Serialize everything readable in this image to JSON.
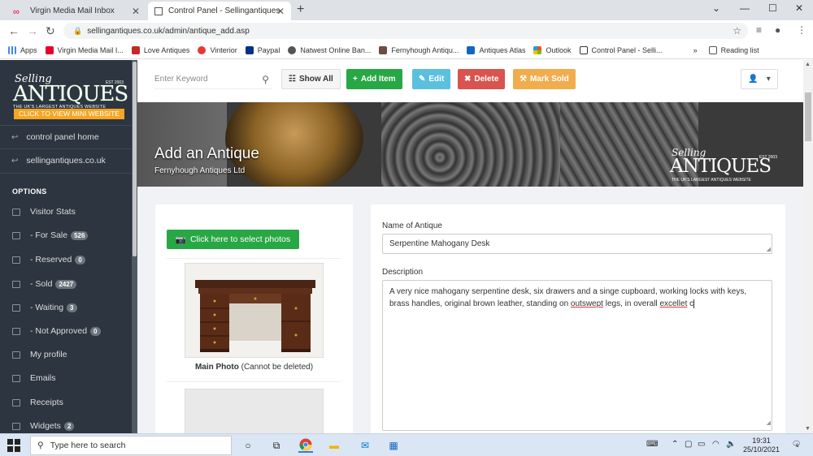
{
  "browser": {
    "tabs": [
      {
        "label": "Virgin Media Mail Inbox"
      },
      {
        "label": "Control Panel - Sellingantiques"
      }
    ],
    "url": "sellingantiques.co.uk/admin/antique_add.asp",
    "bookmarks": [
      {
        "label": "Apps",
        "color": "#4285f4"
      },
      {
        "label": "Virgin Media Mail I...",
        "color": "#e4002b"
      },
      {
        "label": "Love Antiques",
        "color": "#c62828"
      },
      {
        "label": "Vinterior",
        "color": "#e53935"
      },
      {
        "label": "Paypal",
        "color": "#003087"
      },
      {
        "label": "Natwest Online Ban...",
        "color": "#555555"
      },
      {
        "label": "Fernyhough Antiqu...",
        "color": "#6d4c41"
      },
      {
        "label": "Antiques Atlas",
        "color": "#1565c0"
      },
      {
        "label": "Outlook",
        "color": "#0078d4"
      },
      {
        "label": "Control Panel - Selli...",
        "color": "#333333"
      }
    ],
    "more": "»",
    "reading_list": "Reading list"
  },
  "sidebar": {
    "logo_selling": "Selling",
    "logo_antiques": "ANTIQUES",
    "logo_est": "EST 2003",
    "logo_tagline": "THE UK'S LARGEST ANTIQUES WEBSITE",
    "mini_website_button": "CLICK TO VIEW MINI WEBSITE",
    "links": [
      {
        "label": "control panel home"
      },
      {
        "label": "sellingantiques.co.uk"
      }
    ],
    "options_heading": "OPTIONS",
    "items": [
      {
        "label": "Visitor Stats",
        "count": ""
      },
      {
        "label": "- For Sale",
        "count": "526"
      },
      {
        "label": "- Reserved",
        "count": "0"
      },
      {
        "label": "- Sold",
        "count": "2427"
      },
      {
        "label": "- Waiting",
        "count": "3"
      },
      {
        "label": "- Not Approved",
        "count": "0"
      },
      {
        "label": "My profile",
        "count": ""
      },
      {
        "label": "Emails",
        "count": ""
      },
      {
        "label": "Receipts",
        "count": ""
      },
      {
        "label": "Widgets",
        "count": "2"
      }
    ]
  },
  "toolbar": {
    "search_placeholder": "Enter Keyword",
    "show_all": "Show All",
    "add_item": "Add Item",
    "edit": "Edit",
    "delete": "Delete",
    "mark_sold": "Mark Sold",
    "colors": {
      "add": "#28a745",
      "edit": "#5bc0de",
      "delete": "#d9534f",
      "mark_sold": "#f0ad4e"
    }
  },
  "hero": {
    "title": "Add an Antique",
    "subtitle": "Fernyhough Antiques Ltd"
  },
  "photos": {
    "select_button": "Click here to select photos",
    "main_photo_bold": "Main Photo",
    "main_photo_note": "(Cannot be deleted)"
  },
  "form": {
    "name_label": "Name of Antique",
    "name_value": "Serpentine Mahogany Desk",
    "description_label": "Description",
    "description_value_1": "A very nice mahogany serpentine desk, six drawers and a singe cupboard, working locks with keys, brass handles, original brown leather, standing on ",
    "description_misspelled_1": "outswept",
    "description_value_2": " legs, in overall ",
    "description_misspelled_2": "excellet",
    "description_value_3": " c"
  },
  "taskbar": {
    "search_placeholder": "Type here to search",
    "time": "19:31",
    "date": "25/10/2021",
    "notification_count": "6"
  }
}
